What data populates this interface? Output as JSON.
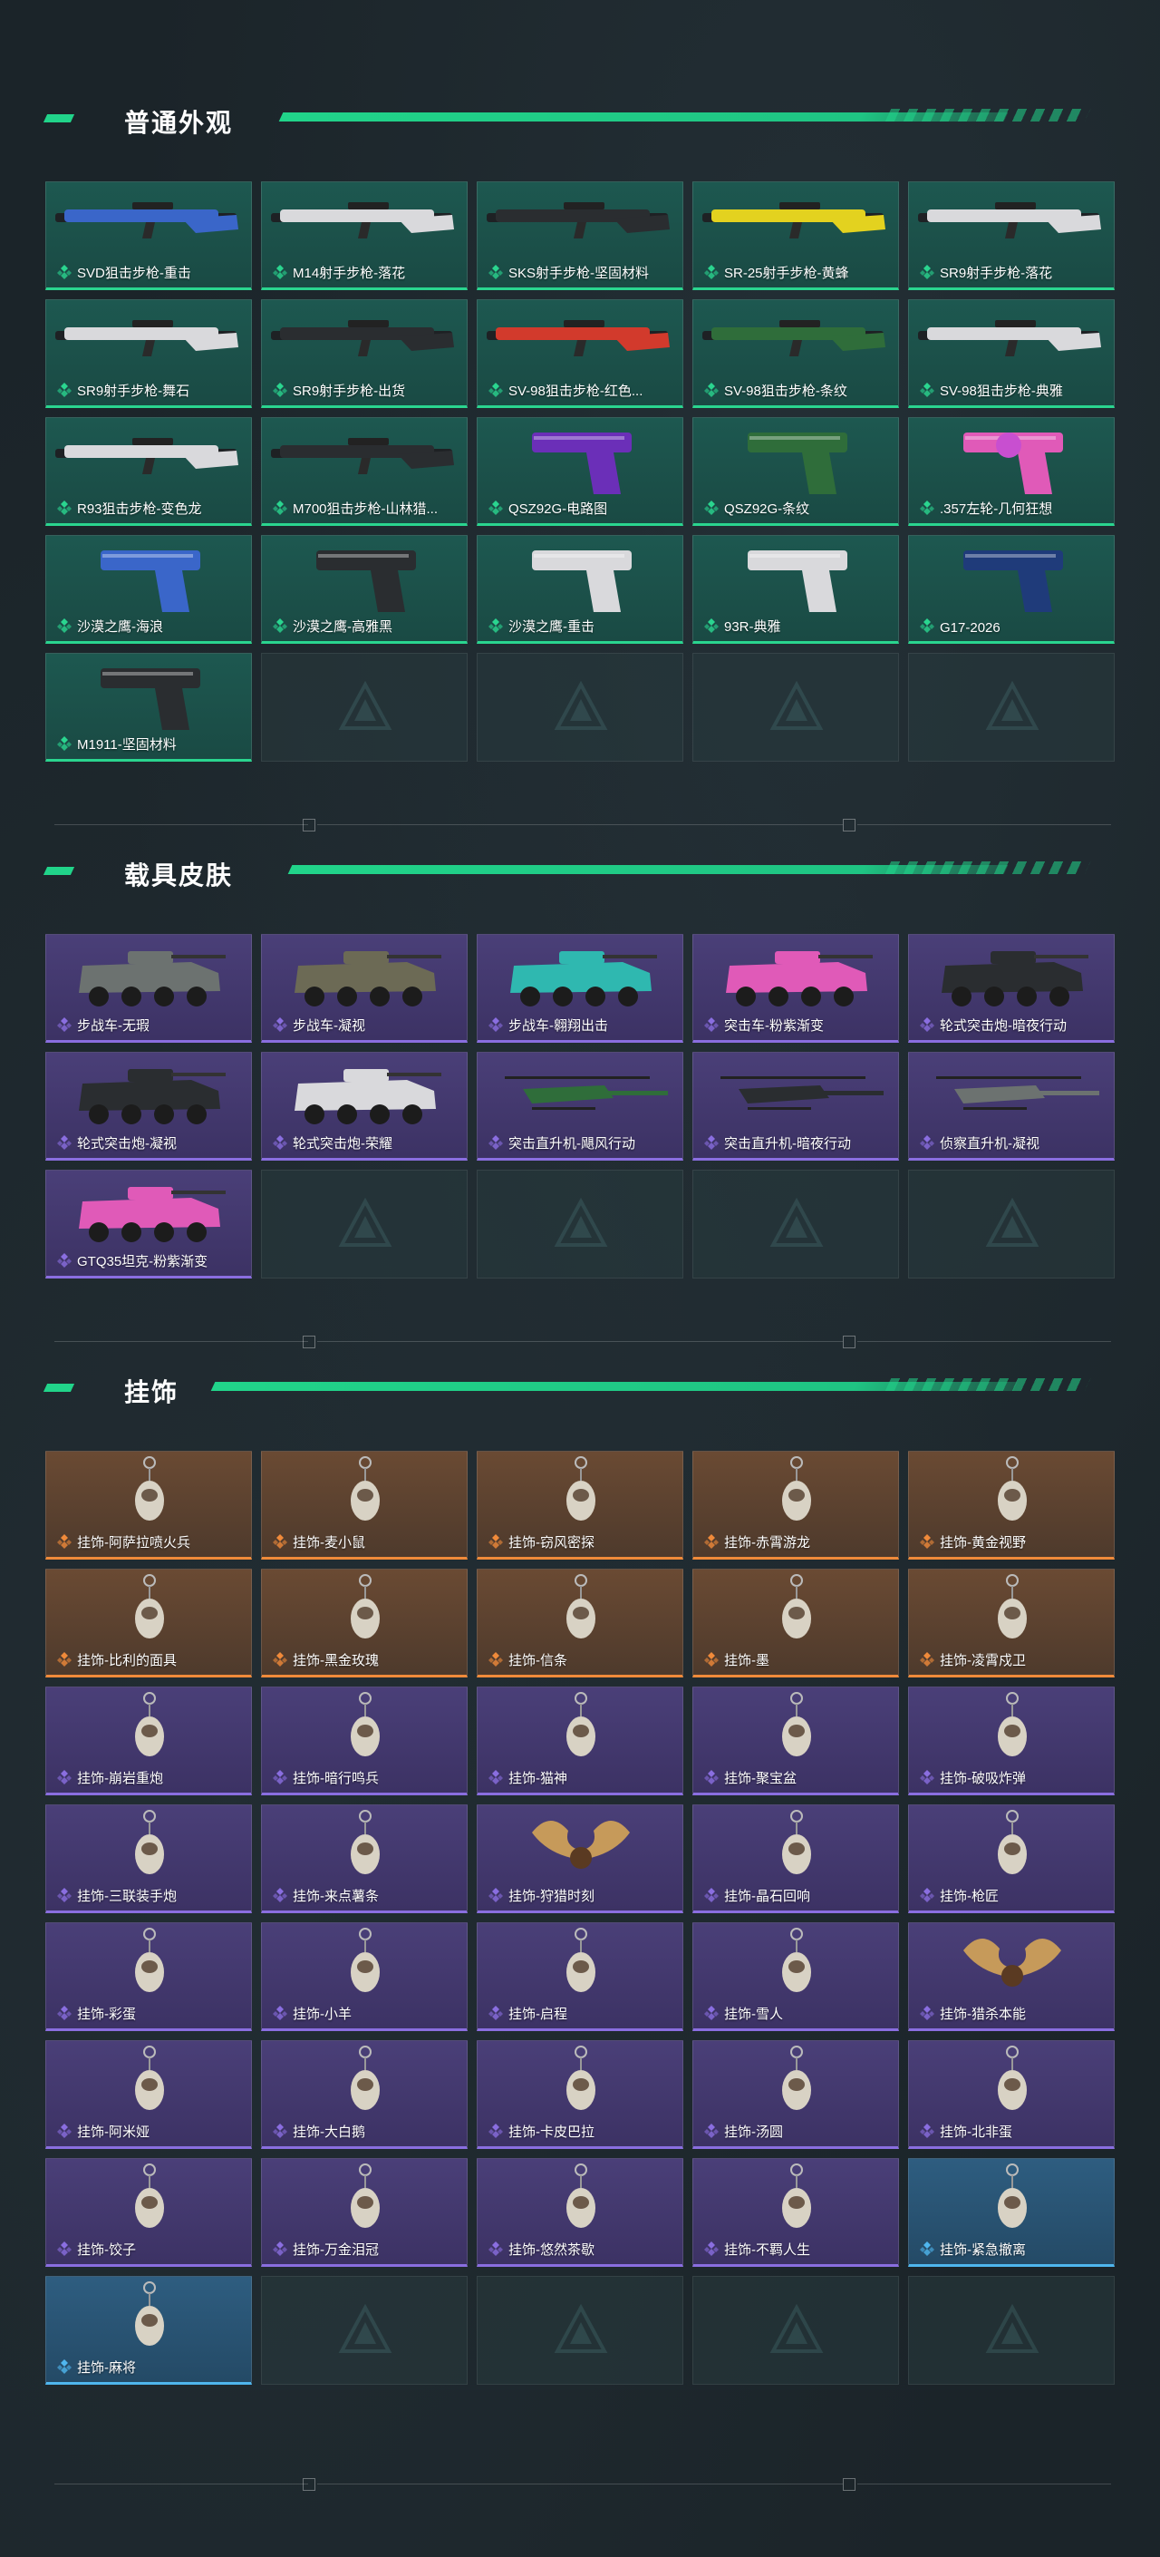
{
  "sections": [
    {
      "title": "普通外观",
      "items": [
        {
          "label": "SVD狙击步枪-重击",
          "tier": "green",
          "art": "rifle-long-blue"
        },
        {
          "label": "M14射手步枪-落花",
          "tier": "green",
          "art": "rifle-white"
        },
        {
          "label": "SKS射手步枪-坚固材料",
          "tier": "green",
          "art": "rifle-dark"
        },
        {
          "label": "SR-25射手步枪-黄蜂",
          "tier": "green",
          "art": "rifle-yellow"
        },
        {
          "label": "SR9射手步枪-落花",
          "tier": "green",
          "art": "rifle-white"
        },
        {
          "label": "SR9射手步枪-舞石",
          "tier": "green",
          "art": "rifle-white"
        },
        {
          "label": "SR9射手步枪-出货",
          "tier": "green",
          "art": "rifle-dark"
        },
        {
          "label": "SV-98狙击步枪-红色...",
          "tier": "green",
          "art": "rifle-red"
        },
        {
          "label": "SV-98狙击步枪-条纹",
          "tier": "green",
          "art": "rifle-green"
        },
        {
          "label": "SV-98狙击步枪-典雅",
          "tier": "green",
          "art": "rifle-white"
        },
        {
          "label": "R93狙击步枪-变色龙",
          "tier": "green",
          "art": "rifle-white"
        },
        {
          "label": "M700狙击步枪-山林猎...",
          "tier": "green",
          "art": "rifle-dark"
        },
        {
          "label": "QSZ92G-电路图",
          "tier": "green",
          "art": "pistol-purple"
        },
        {
          "label": "QSZ92G-条纹",
          "tier": "green",
          "art": "pistol-green"
        },
        {
          "label": ".357左轮-几何狂想",
          "tier": "green",
          "art": "revolver-pink"
        },
        {
          "label": "沙漠之鹰-海浪",
          "tier": "green",
          "art": "pistol-blue"
        },
        {
          "label": "沙漠之鹰-高雅黑",
          "tier": "green",
          "art": "pistol-dark"
        },
        {
          "label": "沙漠之鹰-重击",
          "tier": "green",
          "art": "pistol-white"
        },
        {
          "label": "93R-典雅",
          "tier": "green",
          "art": "pistol-white"
        },
        {
          "label": "G17-2026",
          "tier": "green",
          "art": "pistol-navy"
        },
        {
          "label": "M1911-坚固材料",
          "tier": "green",
          "art": "pistol-dark"
        },
        {
          "label": "",
          "tier": "empty"
        },
        {
          "label": "",
          "tier": "empty"
        },
        {
          "label": "",
          "tier": "empty"
        },
        {
          "label": "",
          "tier": "empty"
        }
      ]
    },
    {
      "title": "载具皮肤",
      "items": [
        {
          "label": "步战车-无瑕",
          "tier": "purple",
          "art": "apc-grey"
        },
        {
          "label": "步战车-凝视",
          "tier": "purple",
          "art": "apc-camo"
        },
        {
          "label": "步战车-翱翔出击",
          "tier": "purple",
          "art": "apc-teal"
        },
        {
          "label": "突击车-粉紫渐变",
          "tier": "purple",
          "art": "jeep-pink"
        },
        {
          "label": "轮式突击炮-暗夜行动",
          "tier": "purple",
          "art": "tank-dark"
        },
        {
          "label": "轮式突击炮-凝视",
          "tier": "purple",
          "art": "tank-dark"
        },
        {
          "label": "轮式突击炮-荣耀",
          "tier": "purple",
          "art": "tank-white"
        },
        {
          "label": "突击直升机-飓风行动",
          "tier": "purple",
          "art": "heli-green"
        },
        {
          "label": "突击直升机-暗夜行动",
          "tier": "purple",
          "art": "heli-dark"
        },
        {
          "label": "侦察直升机-凝视",
          "tier": "purple",
          "art": "heli-grey"
        },
        {
          "label": "GTQ35坦克-粉紫渐变",
          "tier": "purple",
          "art": "tank-pink"
        },
        {
          "label": "",
          "tier": "empty"
        },
        {
          "label": "",
          "tier": "empty"
        },
        {
          "label": "",
          "tier": "empty"
        },
        {
          "label": "",
          "tier": "empty"
        }
      ]
    },
    {
      "title": "挂饰",
      "items": [
        {
          "label": "挂饰-阿萨拉喷火兵",
          "tier": "orange",
          "art": "charm"
        },
        {
          "label": "挂饰-麦小鼠",
          "tier": "orange",
          "art": "charm"
        },
        {
          "label": "挂饰-窃风密探",
          "tier": "orange",
          "art": "charm"
        },
        {
          "label": "挂饰-赤霄游龙",
          "tier": "orange",
          "art": "charm"
        },
        {
          "label": "挂饰-黄金视野",
          "tier": "orange",
          "art": "charm"
        },
        {
          "label": "挂饰-比利的面具",
          "tier": "orange",
          "art": "charm"
        },
        {
          "label": "挂饰-黑金玫瑰",
          "tier": "orange",
          "art": "charm"
        },
        {
          "label": "挂饰-信条",
          "tier": "orange",
          "art": "charm"
        },
        {
          "label": "挂饰-墨",
          "tier": "orange",
          "art": "charm"
        },
        {
          "label": "挂饰-凌霄戍卫",
          "tier": "orange",
          "art": "charm"
        },
        {
          "label": "挂饰-崩岩重炮",
          "tier": "purple",
          "art": "charm"
        },
        {
          "label": "挂饰-暗行鸣兵",
          "tier": "purple",
          "art": "charm"
        },
        {
          "label": "挂饰-猫神",
          "tier": "purple",
          "art": "charm"
        },
        {
          "label": "挂饰-聚宝盆",
          "tier": "purple",
          "art": "charm"
        },
        {
          "label": "挂饰-破吸炸弹",
          "tier": "purple",
          "art": "charm"
        },
        {
          "label": "挂饰-三联装手炮",
          "tier": "purple",
          "art": "charm"
        },
        {
          "label": "挂饰-来点薯条",
          "tier": "purple",
          "art": "charm"
        },
        {
          "label": "挂饰-狩猎时刻",
          "tier": "purple",
          "art": "antler"
        },
        {
          "label": "挂饰-晶石回响",
          "tier": "purple",
          "art": "charm"
        },
        {
          "label": "挂饰-枪匠",
          "tier": "purple",
          "art": "charm"
        },
        {
          "label": "挂饰-彩蛋",
          "tier": "purple",
          "art": "charm"
        },
        {
          "label": "挂饰-小羊",
          "tier": "purple",
          "art": "charm"
        },
        {
          "label": "挂饰-启程",
          "tier": "purple",
          "art": "charm"
        },
        {
          "label": "挂饰-雪人",
          "tier": "purple",
          "art": "charm"
        },
        {
          "label": "挂饰-猎杀本能",
          "tier": "purple",
          "art": "antler"
        },
        {
          "label": "挂饰-阿米娅",
          "tier": "purple",
          "art": "charm"
        },
        {
          "label": "挂饰-大白鹅",
          "tier": "purple",
          "art": "charm"
        },
        {
          "label": "挂饰-卡皮巴拉",
          "tier": "purple",
          "art": "charm"
        },
        {
          "label": "挂饰-汤圆",
          "tier": "purple",
          "art": "charm"
        },
        {
          "label": "挂饰-北非蛋",
          "tier": "purple",
          "art": "charm"
        },
        {
          "label": "挂饰-饺子",
          "tier": "purple",
          "art": "charm"
        },
        {
          "label": "挂饰-万金泪冠",
          "tier": "purple",
          "art": "charm"
        },
        {
          "label": "挂饰-悠然茶歇",
          "tier": "purple",
          "art": "charm"
        },
        {
          "label": "挂饰-不羁人生",
          "tier": "purple",
          "art": "charm"
        },
        {
          "label": "挂饰-紧急撤离",
          "tier": "blue",
          "art": "charm"
        },
        {
          "label": "挂饰-麻将",
          "tier": "blue",
          "art": "charm"
        },
        {
          "label": "",
          "tier": "empty"
        },
        {
          "label": "",
          "tier": "empty"
        },
        {
          "label": "",
          "tier": "empty"
        },
        {
          "label": "",
          "tier": "empty"
        }
      ]
    }
  ],
  "colors": {
    "accent": "#21d48a",
    "green": "#2ad58f",
    "purple": "#8a6ee0",
    "orange": "#f08a3a",
    "blue": "#4fb6ee"
  }
}
